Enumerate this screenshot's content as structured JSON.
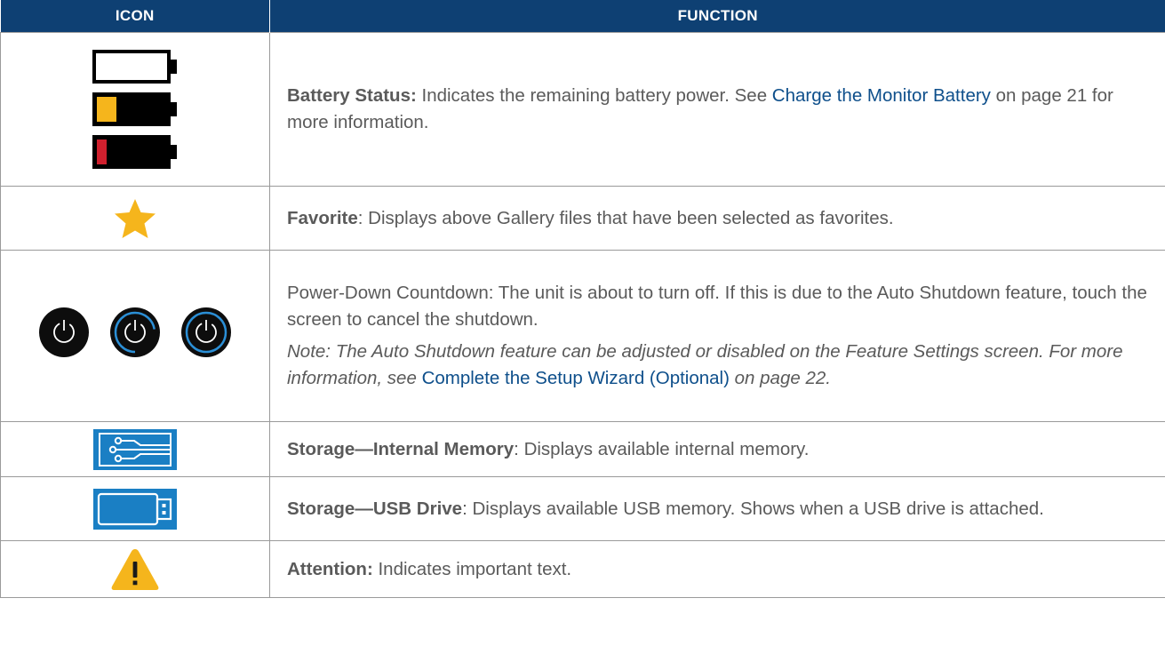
{
  "headers": {
    "icon": "ICON",
    "function": "FUNCTION"
  },
  "rows": [
    {
      "label": "Battery Status:",
      "text": " Indicates the remaining battery power. See ",
      "link": "Charge the Monitor Battery",
      "text_after": " on page 21 for more information.",
      "icons": [
        "battery-empty-icon",
        "battery-low-icon",
        "battery-critical-icon"
      ]
    },
    {
      "label": "Favorite",
      "text": ": Displays above Gallery files that have been selected as favorites.",
      "icons": [
        "star-icon"
      ]
    },
    {
      "text": "Power-Down Countdown: The unit is about to turn off. If this is due to the Auto Shutdown feature, touch the screen to cancel the shutdown.",
      "note": "Note: The Auto Shutdown feature can be adjusted or disabled on the Feature Settings screen. For more information, see ",
      "link": "Complete the Setup Wizard (Optional)",
      "note_after": " on page 22.",
      "icons": [
        "power-countdown-icon",
        "power-countdown-icon",
        "power-countdown-icon"
      ]
    },
    {
      "label": "Storage—Internal Memory",
      "text": ": Displays available internal memory.",
      "icons": [
        "circuit-memory-icon"
      ]
    },
    {
      "label": "Storage—USB Drive",
      "text": ": Displays available USB memory. Shows when a USB drive is attached.",
      "icons": [
        "usb-drive-icon"
      ]
    },
    {
      "label": "Attention:",
      "text": " Indicates important text.",
      "icons": [
        "warning-icon"
      ]
    }
  ],
  "colors": {
    "header_bg": "#0e4073",
    "link": "#0e4f8b",
    "star": "#f5b51c",
    "battery_low": "#f5b51c",
    "battery_critical": "#d0202e",
    "storage_blue": "#1a7fc4",
    "power_ring": "#2b8fd6",
    "warning": "#f5b51c"
  }
}
